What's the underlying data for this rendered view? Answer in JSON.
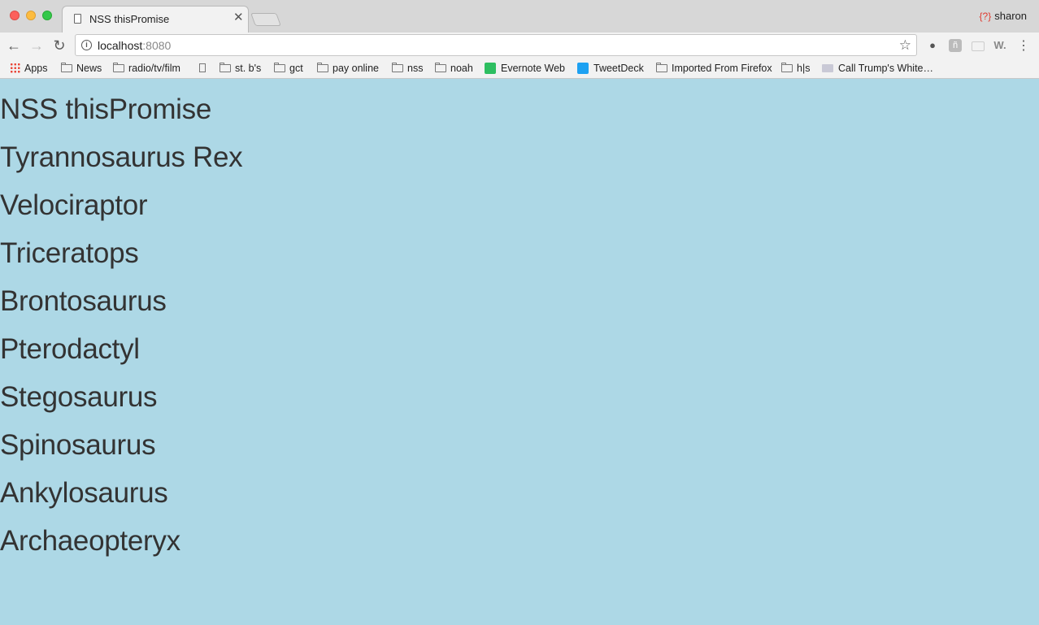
{
  "browser": {
    "tab_title": "NSS thisPromise",
    "profile_name": "sharon",
    "url_host": "localhost",
    "url_port": ":8080",
    "bookmarks": [
      {
        "label": "Apps",
        "icon": "apps-grid-icon"
      },
      {
        "label": "News",
        "icon": "folder-icon"
      },
      {
        "label": "radio/tv/film",
        "icon": "folder-icon"
      },
      {
        "label": "",
        "icon": "page-icon"
      },
      {
        "label": "st. b's",
        "icon": "folder-icon"
      },
      {
        "label": "gct",
        "icon": "folder-icon"
      },
      {
        "label": "pay online",
        "icon": "folder-icon"
      },
      {
        "label": "nss",
        "icon": "folder-icon"
      },
      {
        "label": "noah",
        "icon": "folder-icon"
      },
      {
        "label": "Evernote Web",
        "icon": "evernote-icon"
      },
      {
        "label": "TweetDeck",
        "icon": "tweetdeck-icon"
      },
      {
        "label": "Imported From Firefox",
        "icon": "folder-icon"
      },
      {
        "label": "h|s",
        "icon": "folder-icon"
      },
      {
        "label": "Call Trump's White…",
        "icon": "site-icon"
      }
    ]
  },
  "page": {
    "title": "NSS thisPromise",
    "dinosaurs": [
      "Tyrannosaurus Rex",
      "Velociraptor",
      "Triceratops",
      "Brontosaurus",
      "Pterodactyl",
      "Stegosaurus",
      "Spinosaurus",
      "Ankylosaurus",
      "Archaeopteryx"
    ]
  },
  "colors": {
    "page_background": "#add8e6",
    "heading_text": "#333333"
  }
}
